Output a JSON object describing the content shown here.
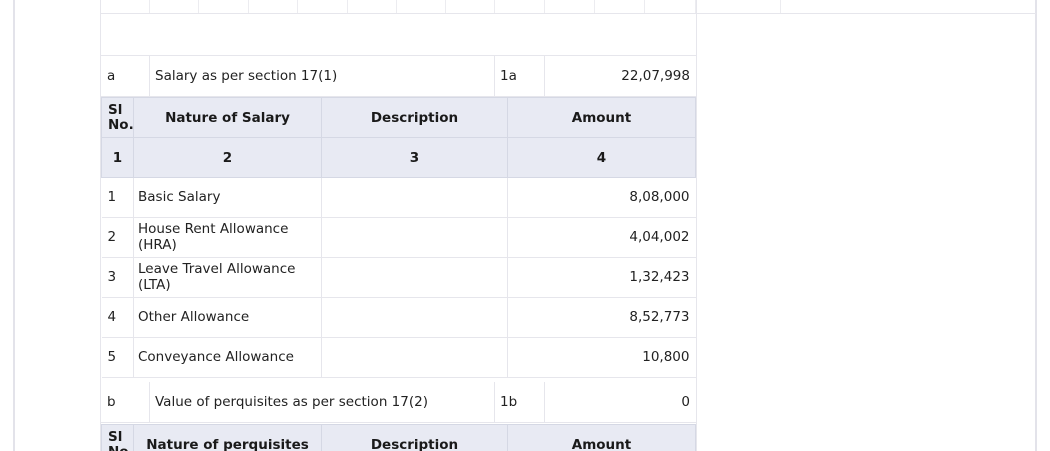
{
  "item_a": {
    "letter": "a",
    "label": "Salary as per section 17(1)",
    "code": "1a",
    "amount": "22,07,998"
  },
  "salary_table": {
    "headers": [
      "Sl No.",
      "Nature of Salary",
      "Description",
      "Amount"
    ],
    "header_numbers": [
      "1",
      "2",
      "3",
      "4"
    ],
    "rows": [
      {
        "sl": "1",
        "nature": "Basic Salary",
        "description": "",
        "amount": "8,08,000"
      },
      {
        "sl": "2",
        "nature": "House Rent Allowance (HRA)",
        "description": "",
        "amount": "4,04,002"
      },
      {
        "sl": "3",
        "nature": "Leave Travel Allowance (LTA)",
        "description": "",
        "amount": "1,32,423"
      },
      {
        "sl": "4",
        "nature": "Other Allowance",
        "description": "",
        "amount": "8,52,773"
      },
      {
        "sl": "5",
        "nature": "Conveyance Allowance",
        "description": "",
        "amount": "10,800"
      }
    ]
  },
  "item_b": {
    "letter": "b",
    "label": "Value of perquisites as per section 17(2)",
    "code": "1b",
    "amount": "0"
  },
  "perquisites_table": {
    "headers": [
      "Sl No.",
      "Nature of perquisites",
      "Description",
      "Amount"
    ]
  }
}
